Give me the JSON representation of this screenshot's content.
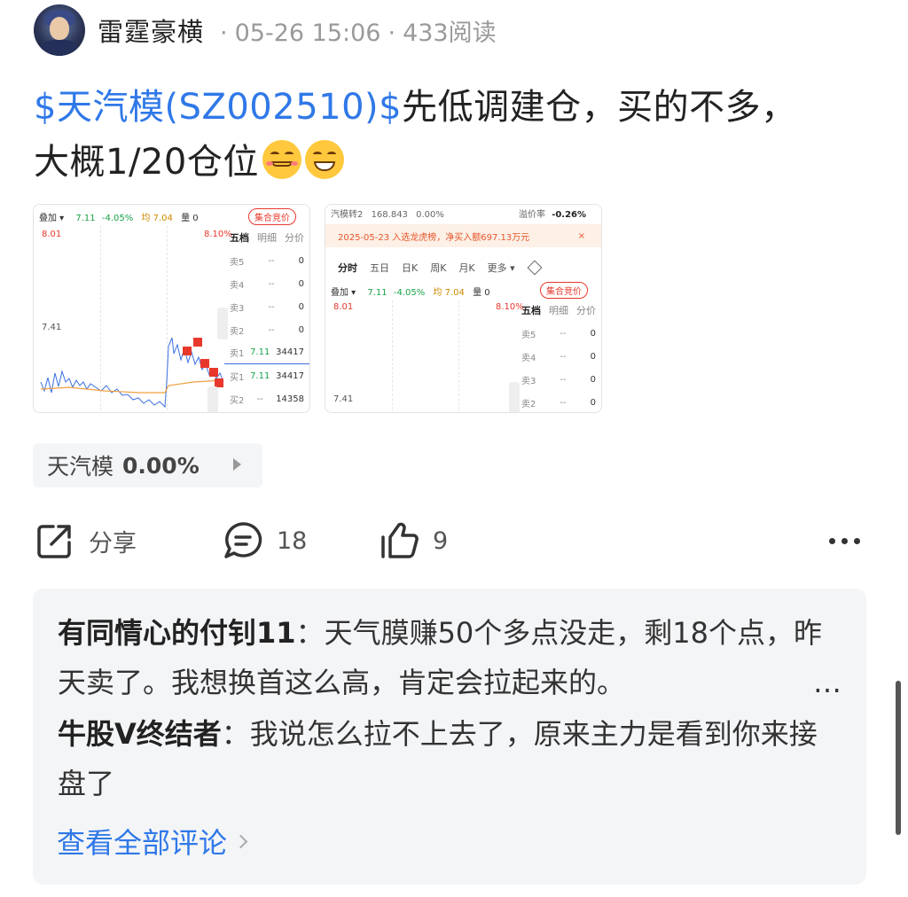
{
  "post": {
    "author": "雷霆豪横",
    "time": "05-26 15:06",
    "reads": "433阅读",
    "stock_link": "$天汽模(SZ002510)$",
    "text_line1": "先低调建仓，买的不多，",
    "text_line2": "大概1/20仓位"
  },
  "thumb1": {
    "overlay_label": "叠加 ▾",
    "price": "7.11",
    "change": "-4.05%",
    "avg": "均 7.04",
    "vol": "量 0",
    "auction": "集合竞价",
    "high": "8.01",
    "high_pct": "8.10%",
    "low": "7.41",
    "panel_header": [
      "五档",
      "明细",
      "分价"
    ],
    "rows": [
      {
        "label": "卖5",
        "price": "--",
        "vol": "0"
      },
      {
        "label": "卖4",
        "price": "--",
        "vol": "0"
      },
      {
        "label": "卖3",
        "price": "--",
        "vol": "0"
      },
      {
        "label": "卖2",
        "price": "--",
        "vol": "0"
      },
      {
        "label": "卖1",
        "price": "7.11",
        "vol": "34417"
      },
      {
        "label": "买1",
        "price": "7.11",
        "vol": "34417"
      },
      {
        "label": "买2",
        "price": "--",
        "vol": "14358"
      }
    ]
  },
  "thumb2": {
    "bond": "汽模转2",
    "bond_price": "168.843",
    "bond_pct": "0.00%",
    "premium_label": "溢价率",
    "premium": "-0.26%",
    "banner": "2025-05-23 入选龙虎榜，净买入额697.13万元",
    "banner_close": "×",
    "tabs": [
      "分时",
      "五日",
      "日K",
      "周K",
      "月K",
      "更多 ▾"
    ],
    "overlay_label": "叠加 ▾",
    "price": "7.11",
    "change": "-4.05%",
    "avg": "均 7.04",
    "vol": "量 0",
    "auction": "集合竞价",
    "high": "8.01",
    "high_pct": "8.10%",
    "low": "7.41",
    "panel_header": [
      "五档",
      "明细",
      "分价"
    ],
    "rows": [
      {
        "label": "卖5",
        "price": "--",
        "vol": "0"
      },
      {
        "label": "卖4",
        "price": "--",
        "vol": "0"
      },
      {
        "label": "卖3",
        "price": "--",
        "vol": "0"
      },
      {
        "label": "卖2",
        "price": "--",
        "vol": "0"
      }
    ]
  },
  "stock_chip": {
    "name": "天汽模",
    "change": "0.00%"
  },
  "actions": {
    "share_label": "分享",
    "comment_count": "18",
    "like_count": "9"
  },
  "comments": [
    {
      "author": "有同情心的付钊11",
      "sep": "：",
      "text": "天气膜赚50个多点没走，剩18个点，昨天卖了。我想换首这么高，肯定会拉起来的。",
      "truncated": "…"
    },
    {
      "author": "牛股V终结者",
      "sep": "：",
      "text": "我说怎么拉不上去了，原来主力是看到你来接盘了"
    }
  ],
  "view_all_comments": "查看全部评论",
  "colors": {
    "link_blue": "#2f78e8",
    "rise_red": "#e8382b",
    "fall_green": "#1aa34a",
    "panel_bg": "#f4f5f7"
  }
}
